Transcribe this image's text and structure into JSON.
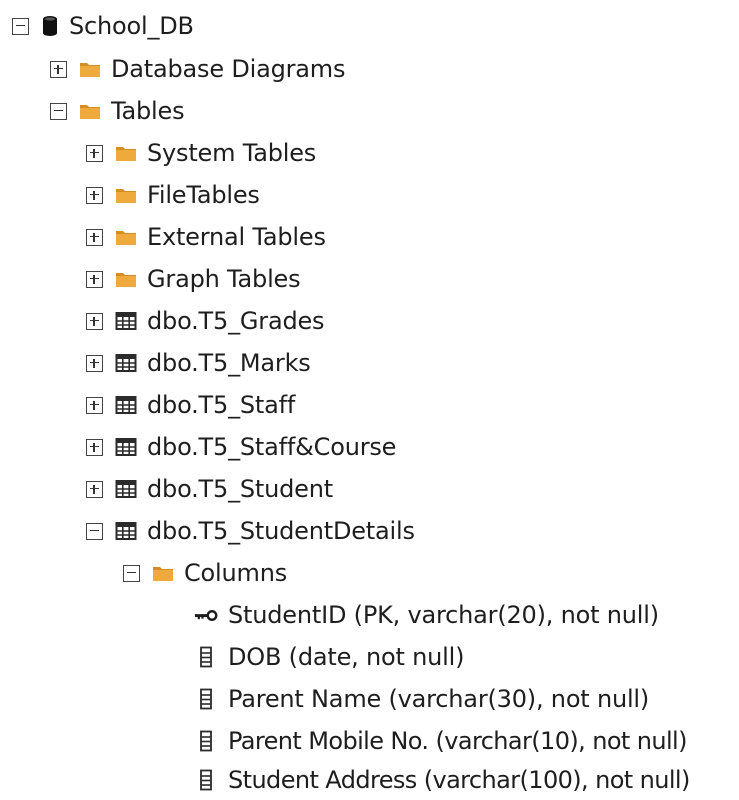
{
  "tree": {
    "database": {
      "label": "School_DB",
      "icon": "database-icon",
      "expanded": true
    },
    "database_diagrams": {
      "label": "Database Diagrams",
      "icon": "folder-icon",
      "expanded": false
    },
    "tables": {
      "label": "Tables",
      "icon": "folder-icon",
      "expanded": true
    },
    "system_tables": {
      "label": "System Tables",
      "icon": "folder-icon",
      "expanded": false
    },
    "file_tables": {
      "label": "FileTables",
      "icon": "folder-icon",
      "expanded": false
    },
    "external_tables": {
      "label": "External Tables",
      "icon": "folder-icon",
      "expanded": false
    },
    "graph_tables": {
      "label": "Graph Tables",
      "icon": "folder-icon",
      "expanded": false
    },
    "table_grades": {
      "label": "dbo.T5_Grades",
      "icon": "table-icon",
      "expanded": false
    },
    "table_marks": {
      "label": "dbo.T5_Marks",
      "icon": "table-icon",
      "expanded": false
    },
    "table_staff": {
      "label": "dbo.T5_Staff",
      "icon": "table-icon",
      "expanded": false
    },
    "table_staff_course": {
      "label": "dbo.T5_Staff&Course",
      "icon": "table-icon",
      "expanded": false
    },
    "table_student": {
      "label": "dbo.T5_Student",
      "icon": "table-icon",
      "expanded": false
    },
    "table_student_details": {
      "label": "dbo.T5_StudentDetails",
      "icon": "table-icon",
      "expanded": true
    },
    "columns_folder": {
      "label": "Columns",
      "icon": "folder-icon",
      "expanded": true
    },
    "columns": [
      {
        "label": "StudentID (PK, varchar(20), not null)",
        "icon": "primary-key-icon"
      },
      {
        "label": "DOB (date, not null)",
        "icon": "column-icon"
      },
      {
        "label": "Parent Name (varchar(30), not null)",
        "icon": "column-icon"
      },
      {
        "label": "Parent Mobile No. (varchar(10), not null)",
        "icon": "column-icon"
      },
      {
        "label": "Student Address (varchar(100), not null)",
        "icon": "column-icon"
      }
    ]
  },
  "colors": {
    "folder": "#e9a83a",
    "folder_tab": "#d48e22",
    "database": "#111111",
    "table_grid": "#2b2b2b",
    "text": "#1e1e1e"
  }
}
